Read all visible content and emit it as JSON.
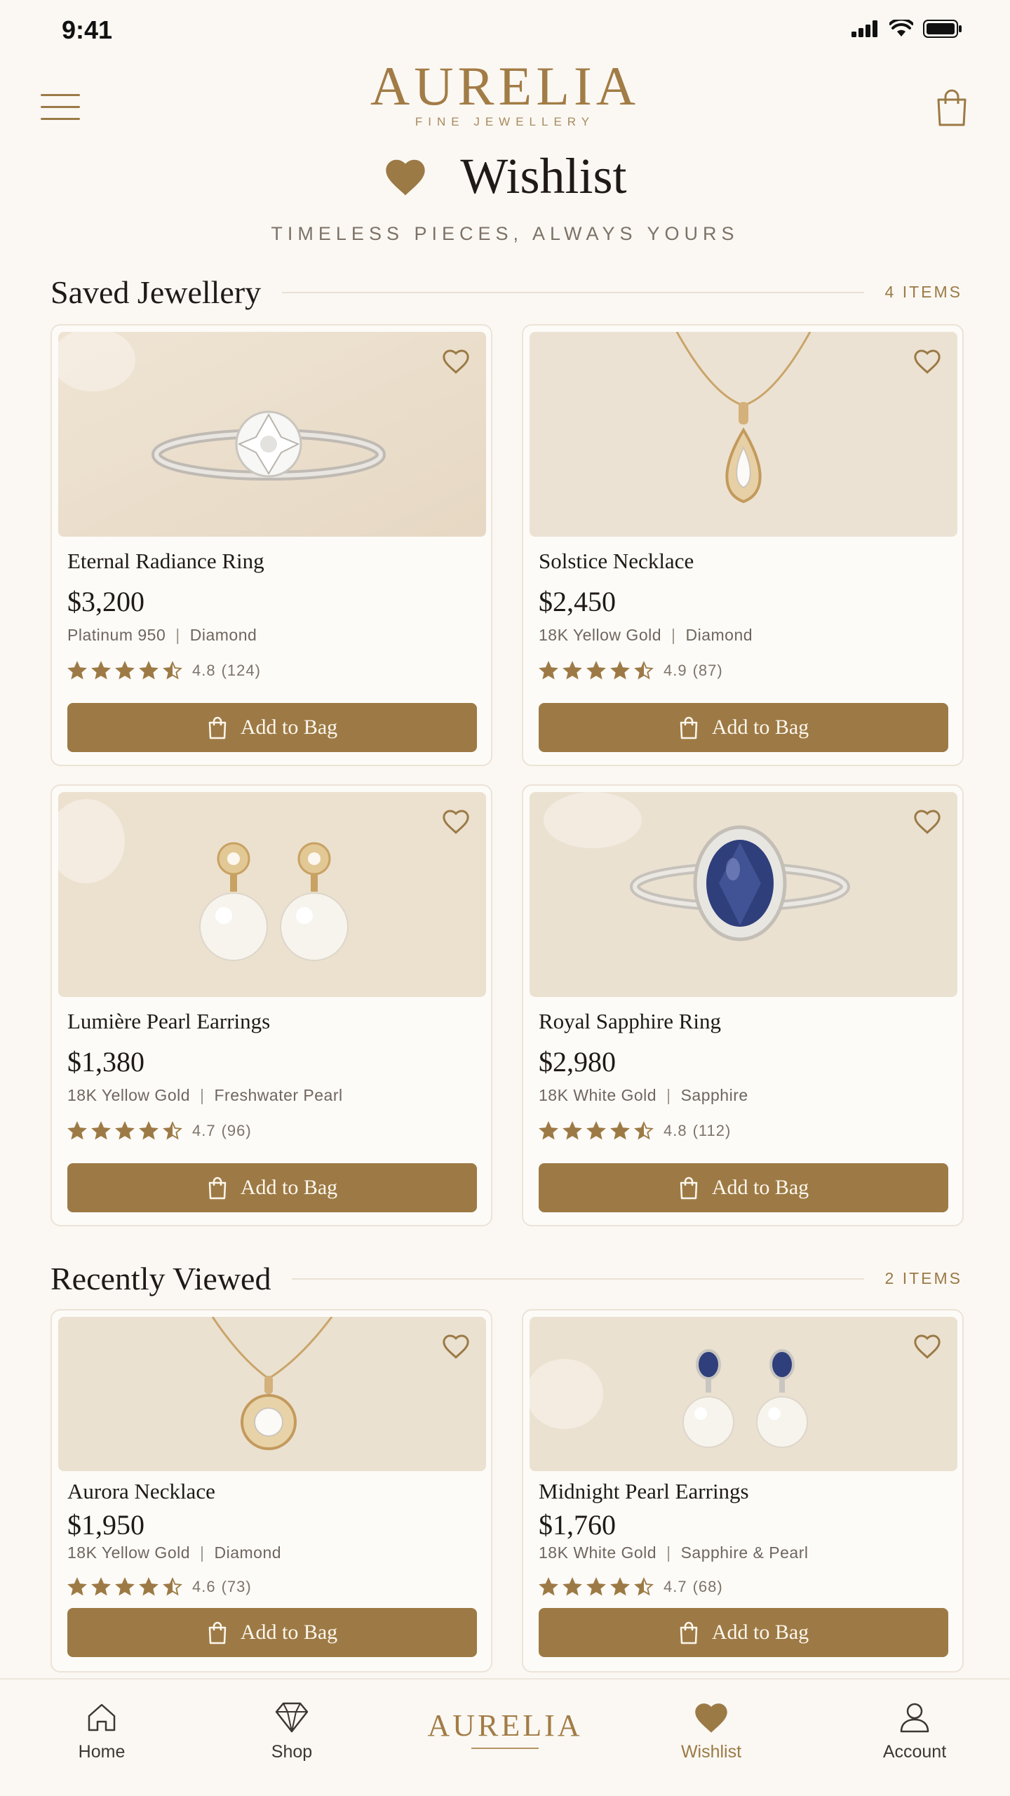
{
  "status_bar": {
    "time": "9:41"
  },
  "header": {
    "brand": "AURELIA",
    "tagline": "FINE JEWELLERY"
  },
  "page": {
    "title": "Wishlist",
    "subtitle": "TIMELESS PIECES, ALWAYS YOURS"
  },
  "saved": {
    "title": "Saved Jewellery",
    "count": "4 ITEMS",
    "items": [
      {
        "name": "Eternal Radiance Ring",
        "price": "$3,200",
        "metal": "Platinum 950",
        "stone": "Diamond",
        "rating": "4.8",
        "reviews": "(124)",
        "cta": "Add to Bag",
        "stars": 4.5
      },
      {
        "name": "Solstice Necklace",
        "price": "$2,450",
        "metal": "18K Yellow Gold",
        "stone": "Diamond",
        "rating": "4.9",
        "reviews": "(87)",
        "cta": "Add to Bag",
        "stars": 4.5
      },
      {
        "name": "Lumière Pearl Earrings",
        "price": "$1,380",
        "metal": "18K Yellow Gold",
        "stone": "Freshwater Pearl",
        "rating": "4.7",
        "reviews": "(96)",
        "cta": "Add to Bag",
        "stars": 4.5
      },
      {
        "name": "Royal Sapphire Ring",
        "price": "$2,980",
        "metal": "18K White Gold",
        "stone": "Sapphire",
        "rating": "4.8",
        "reviews": "(112)",
        "cta": "Add to Bag",
        "stars": 4.5
      }
    ]
  },
  "recent": {
    "title": "Recently Viewed",
    "count": "2 ITEMS",
    "items": [
      {
        "name": "Aurora Necklace",
        "price": "$1,950",
        "metal": "18K Yellow Gold",
        "stone": "Diamond",
        "rating": "4.6",
        "reviews": "(73)",
        "cta": "Add to Bag",
        "stars": 4.5
      },
      {
        "name": "Midnight Pearl Earrings",
        "price": "$1,760",
        "metal": "18K White Gold",
        "stone": "Sapphire & Pearl",
        "rating": "4.7",
        "reviews": "(68)",
        "cta": "Add to Bag",
        "stars": 4.5
      }
    ]
  },
  "nav": {
    "home": "Home",
    "shop": "Shop",
    "brand": "AURELIA",
    "wishlist": "Wishlist",
    "account": "Account"
  },
  "colors": {
    "accent": "#9d7a45",
    "background": "#fbf8f3",
    "card_border": "#ece3d6",
    "sapphire": "#2f3f7c"
  },
  "icons": {
    "menu": "hamburger-icon",
    "bag": "shopping-bag-icon",
    "favorite": "heart-outline-icon",
    "title": "heart-filled-icon",
    "star": "star-icon",
    "home": "home-icon",
    "shop": "diamond-icon",
    "wishlist": "heart-filled-icon",
    "account": "user-icon"
  }
}
